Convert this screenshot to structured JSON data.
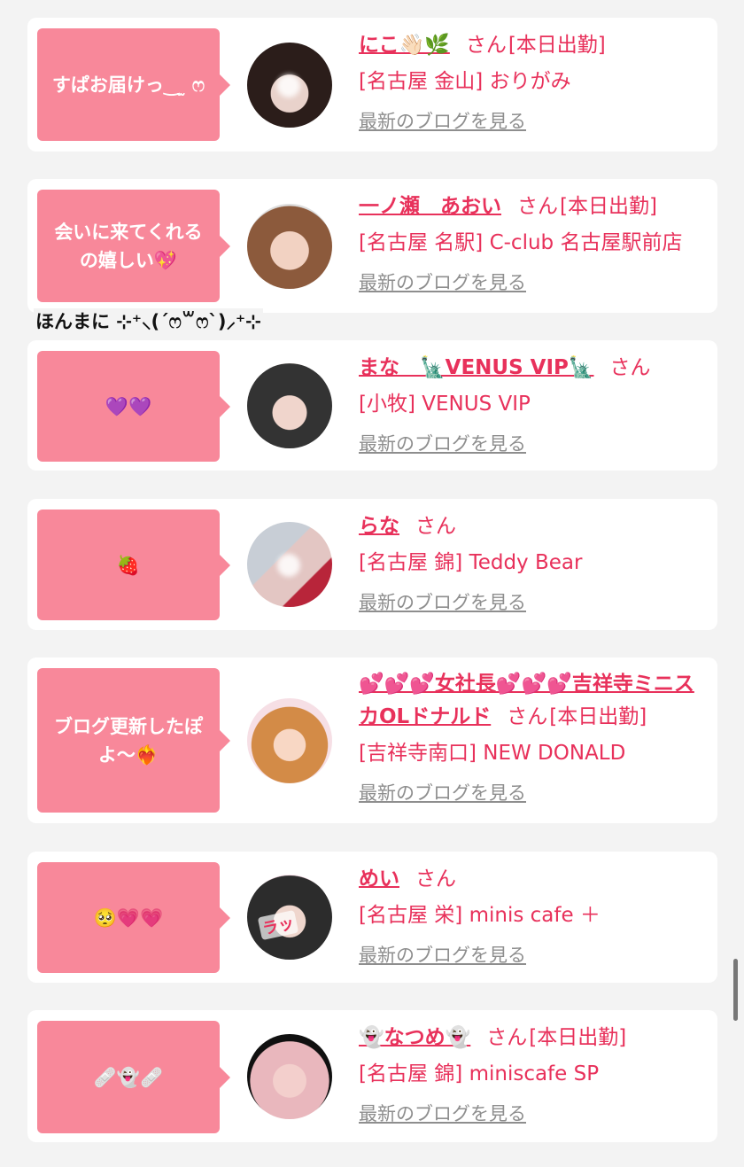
{
  "floating_text": "ほんまに ⊹⁺⸜(ˊෆ꒳ෆˋ)⸝⁺⊹",
  "common": {
    "honorific": "さん",
    "blog_link": "最新のブログを見る"
  },
  "cards": [
    {
      "bubble": "すぱお届けっ‿ ̫ ෆ",
      "name": "にこ👋🏻🌿",
      "today": "[本日出勤]",
      "shop": "[名古屋 金山] おりがみ"
    },
    {
      "bubble": "会いに来てくれるの嬉しい💖",
      "name": "一ノ瀬　あおい",
      "today": "[本日出勤]",
      "shop": "[名古屋 名駅] C-club 名古屋駅前店"
    },
    {
      "bubble": "💜💜",
      "name": "まな　🗽VENUS VIP🗽",
      "today": "",
      "shop": "[小牧] VENUS VIP"
    },
    {
      "bubble": "🍓",
      "name": "らな",
      "today": "",
      "shop": "[名古屋 錦] Teddy Bear"
    },
    {
      "bubble": "ブログ更新したぽよ〜❤️‍🔥",
      "name": "💕💕💕女社長💕💕💕吉祥寺ミニスカOLドナルド",
      "today": "[本日出勤]",
      "shop": "[吉祥寺南口] NEW DONALD"
    },
    {
      "bubble": "🥺💗💗",
      "name": "めい",
      "today": "",
      "shop": "[名古屋 栄] minis cafe ＋",
      "avatar_stamp": "ラッ"
    },
    {
      "bubble": "🩹👻🩹",
      "name": "👻なつめ👻",
      "today": "[本日出勤]",
      "shop": "[名古屋 錦] miniscafe SP"
    }
  ]
}
